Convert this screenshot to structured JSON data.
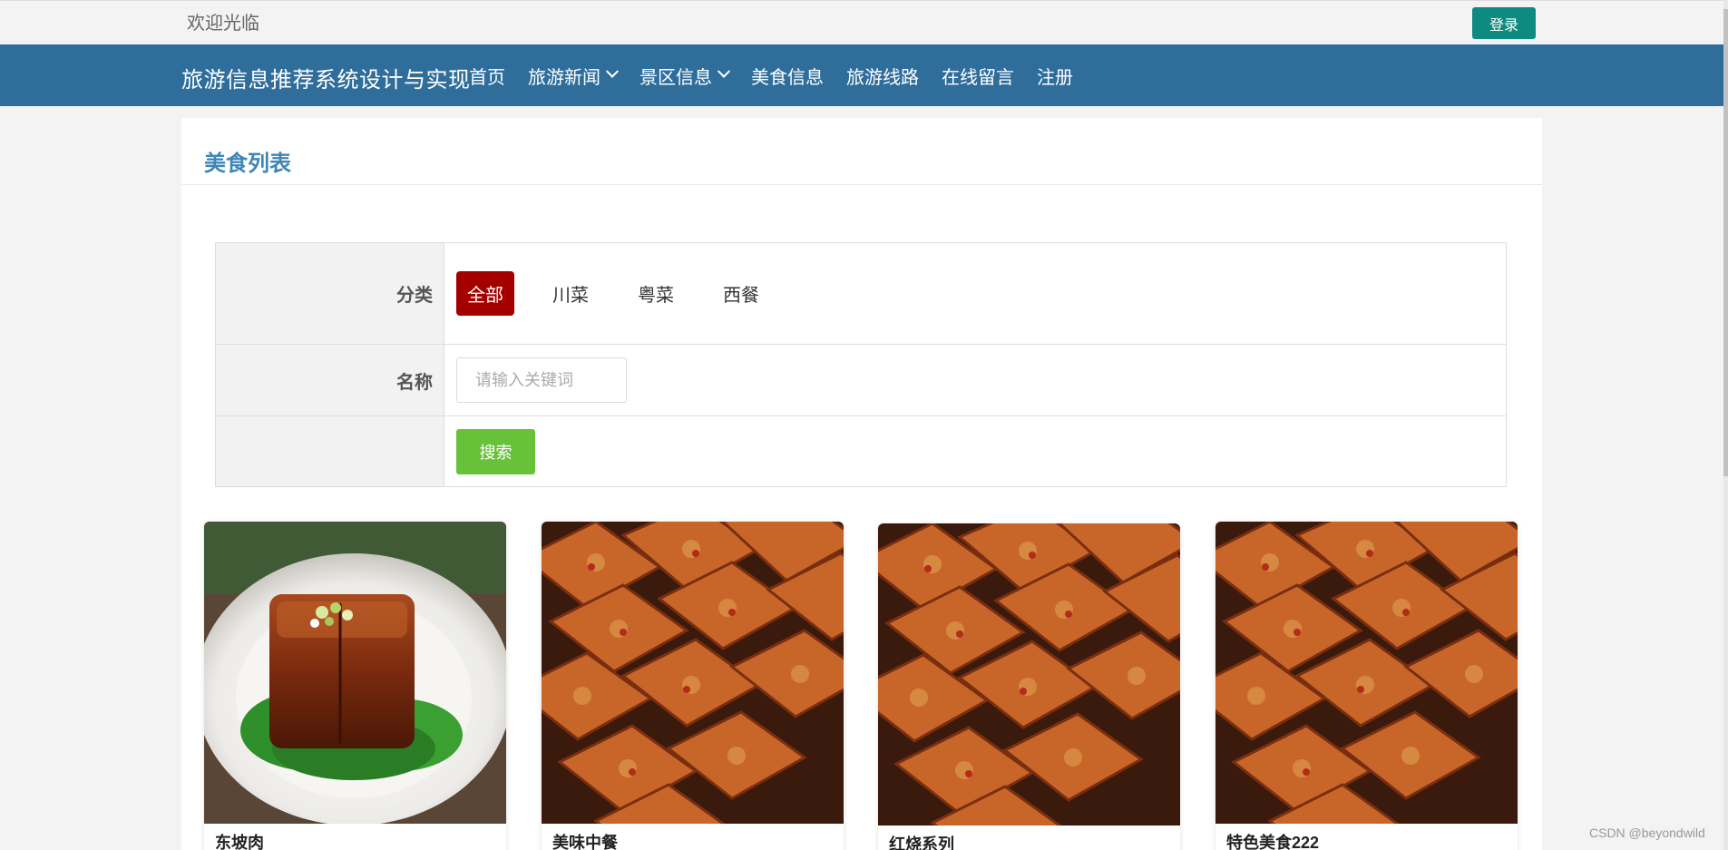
{
  "topbar": {
    "welcome": "欢迎光临",
    "login_label": "登录"
  },
  "navbar": {
    "brand": "旅游信息推荐系统设计与实现",
    "items": [
      {
        "label": "首页",
        "dropdown": false
      },
      {
        "label": "旅游新闻",
        "dropdown": true
      },
      {
        "label": "景区信息",
        "dropdown": true
      },
      {
        "label": "美食信息",
        "dropdown": false
      },
      {
        "label": "旅游线路",
        "dropdown": false
      },
      {
        "label": "在线留言",
        "dropdown": false
      },
      {
        "label": "注册",
        "dropdown": false
      }
    ]
  },
  "panel": {
    "title": "美食列表",
    "filter": {
      "category_label": "分类",
      "categories": [
        "全部",
        "川菜",
        "粤菜",
        "西餐"
      ],
      "active_category": "全部",
      "name_label": "名称",
      "name_placeholder": "请输入关键词",
      "name_value": "",
      "search_label": "搜索"
    },
    "cards": [
      {
        "name": "东坡肉",
        "image": "braised-pork"
      },
      {
        "name": "美味中餐",
        "image": "fried-tofu"
      },
      {
        "name": "红烧系列",
        "image": "fried-tofu"
      },
      {
        "name": "特色美食222",
        "image": "fried-tofu"
      }
    ]
  },
  "watermark": "CSDN @beyondwild",
  "colors": {
    "nav_bg": "#2f6d9b",
    "title_blue": "#3f86b4",
    "login_green": "#0e8b80",
    "active_red": "#a40000",
    "search_green": "#67c23a"
  }
}
